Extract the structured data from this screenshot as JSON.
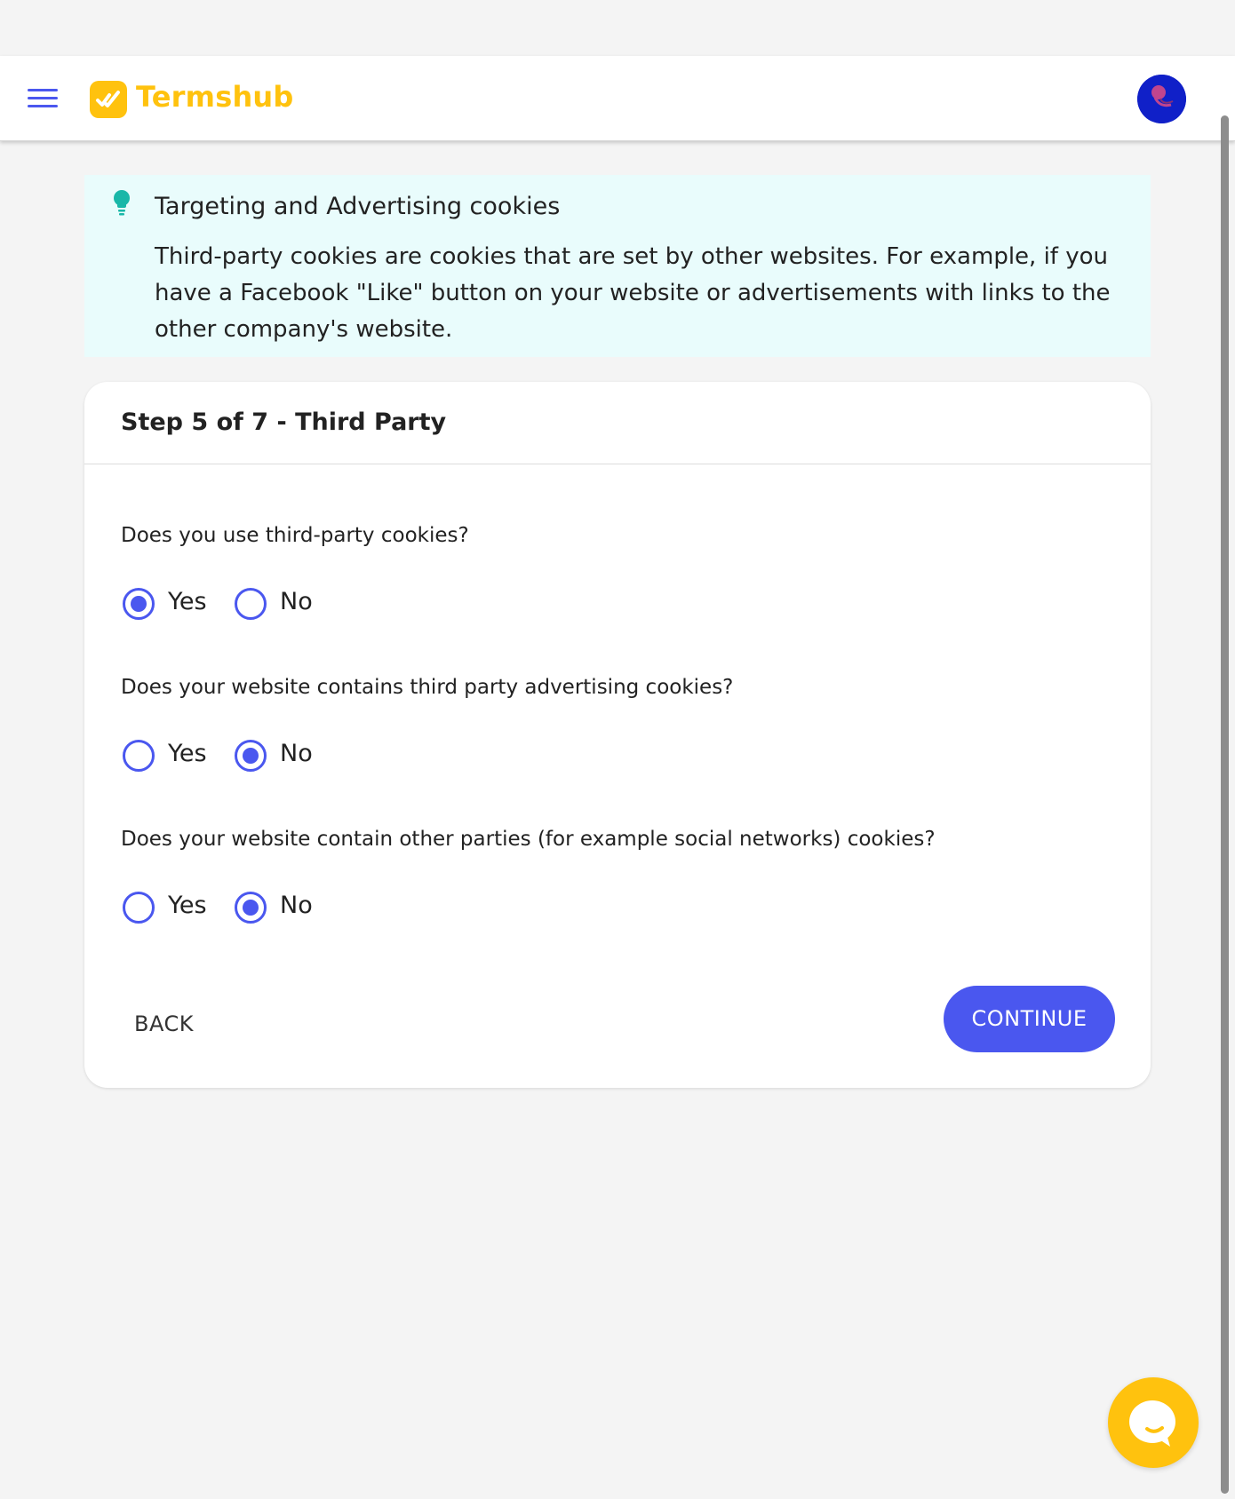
{
  "app": {
    "name": "Termshub"
  },
  "info": {
    "title": "Targeting and Advertising cookies",
    "text": "Third-party cookies are cookies that are set by other websites. For example, if you have a Facebook \"Like\" button on your website or advertisements with links to the other company's website."
  },
  "step": {
    "title": "Step 5 of 7 - Third Party"
  },
  "questions": [
    {
      "text": "Does you use third-party cookies?",
      "yes_label": "Yes",
      "no_label": "No",
      "selected": "Yes"
    },
    {
      "text": "Does your website contains third party advertising cookies?",
      "yes_label": "Yes",
      "no_label": "No",
      "selected": "No"
    },
    {
      "text": "Does your website contain other parties (for example social networks) cookies?",
      "yes_label": "Yes",
      "no_label": "No",
      "selected": "No"
    }
  ],
  "actions": {
    "back_label": "BACK",
    "continue_label": "CONTINUE"
  },
  "icons": {
    "menu": "hamburger-menu-icon",
    "logo": "termshub-logo-icon",
    "avatar": "user-avatar",
    "tip": "lightbulb-icon",
    "chat": "chat-bubble-icon"
  },
  "colors": {
    "accent": "#4a57ef",
    "brand": "#ffc20e",
    "tip_icon": "#19b7a8",
    "info_bg": "#e9fcfc"
  }
}
